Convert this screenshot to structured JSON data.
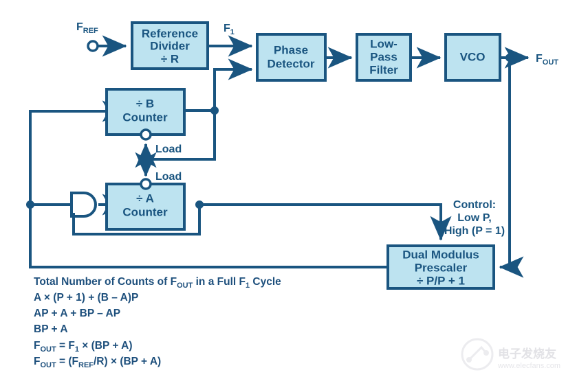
{
  "diagram": {
    "title": "Dual Modulus Prescaler PLL Frequency Synthesizer Block Diagram",
    "colors": {
      "box_fill": "#bde3f0",
      "line": "#1a5580",
      "text": "#1a5580",
      "background": "#ffffff",
      "watermark": "#e2e2e6"
    },
    "blocks": [
      {
        "id": "reference_divider",
        "line1": "Reference",
        "line2": "Divider",
        "line3": "÷ R"
      },
      {
        "id": "phase_detector",
        "line1": "Phase",
        "line2": "Detector"
      },
      {
        "id": "low_pass_filter",
        "line1": "Low-",
        "line2": "Pass",
        "line3": "Filter"
      },
      {
        "id": "vco",
        "line1": "VCO"
      },
      {
        "id": "b_counter",
        "line1": "÷ B",
        "line2": "Counter"
      },
      {
        "id": "a_counter",
        "line1": "÷ A",
        "line2": "Counter"
      },
      {
        "id": "dual_modulus_prescaler",
        "line1": "Dual Modulus",
        "line2": "Prescaler",
        "line3": "÷ P/P + 1"
      }
    ],
    "signal_labels": {
      "f_ref_main": "F",
      "f_ref_sub": "REF",
      "f1_main": "F",
      "f1_sub": "1",
      "f_out_main": "F",
      "f_out_sub": "OUT",
      "load_top": "Load",
      "load_bottom": "Load"
    },
    "control_note": {
      "line1": "Control:",
      "line2": "Low P,",
      "line3": "High (P = 1)"
    },
    "formulas": [
      "Total Number of Counts of F_OUT in a Full F_1 Cycle",
      "A × (P + 1) + (B – A)P",
      "AP + A + BP – AP",
      "BP + A",
      "F_OUT = F_1 × (BP + A)",
      "F_OUT = (F_REF/R) × (BP + A)"
    ],
    "formula_parts": {
      "line1_a": "Total Number of Counts of F",
      "line1_sub1": "OUT",
      "line1_b": " in a Full F",
      "line1_sub2": "1",
      "line1_c": " Cycle",
      "line2": "A × (P + 1) + (B – A)P",
      "line3": "AP + A + BP – AP",
      "line4": "BP + A",
      "line5_a": "F",
      "line5_sub1": "OUT",
      "line5_b": " = F",
      "line5_sub2": "1",
      "line5_c": " × (BP + A)",
      "line6_a": "F",
      "line6_sub1": "OUT",
      "line6_b": " = (F",
      "line6_sub2": "REF",
      "line6_c": "/R) × (BP + A)"
    },
    "watermark": {
      "chinese": "电子发烧友",
      "url": "www.elecfans.com"
    }
  }
}
